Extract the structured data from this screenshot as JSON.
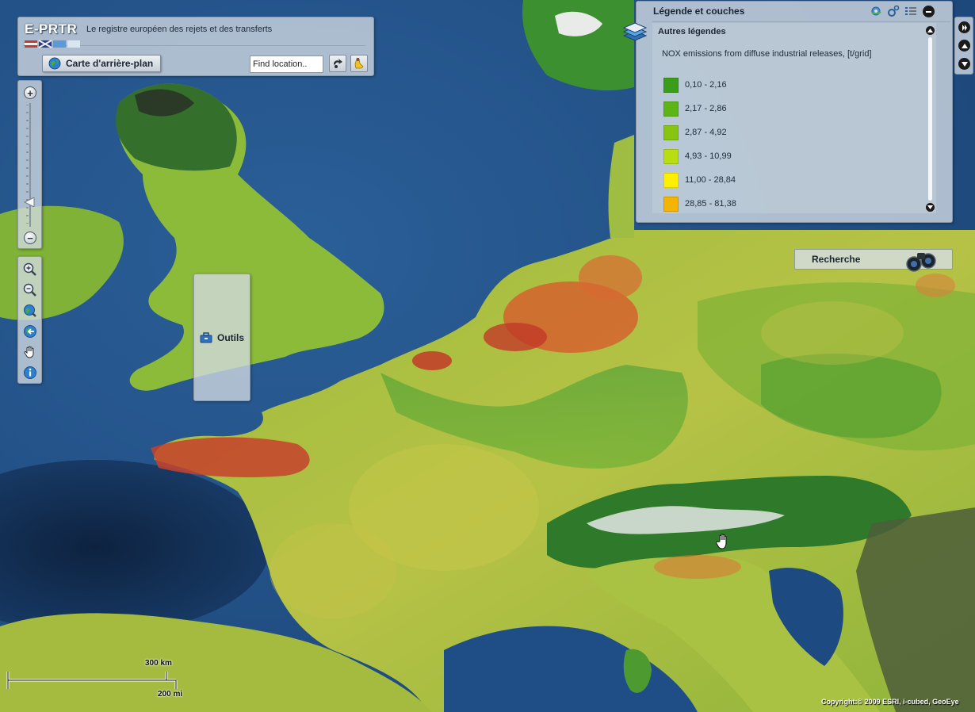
{
  "header": {
    "logo": "E-PRTR",
    "tagline": "Le registre européen des rejets et des transferts",
    "background_map_button": "Carte d'arrière-plan",
    "tools_button": "Outils",
    "find_placeholder": "Find location..",
    "icons": [
      "globe-icon",
      "toolbox-icon",
      "search-go-icon",
      "clear-icon"
    ]
  },
  "zoom_slider": {
    "level": 0.2,
    "icons": [
      "zoom-in-icon",
      "zoom-out-icon"
    ]
  },
  "nav_tools": {
    "icons": [
      "zoom-in-tool-icon",
      "zoom-out-tool-icon",
      "full-extent-icon",
      "previous-extent-icon",
      "pan-hand-icon",
      "identify-info-icon"
    ]
  },
  "legend": {
    "title": "Légende et couches",
    "section": "Autres légendes",
    "subtitle": "NOX emissions from diffuse industrial releases, [t/grid]",
    "entries": [
      {
        "label": "0,10 - 2,16",
        "color": "#3a9e1a"
      },
      {
        "label": "2,17 - 2,86",
        "color": "#5db515"
      },
      {
        "label": "2,87 - 4,92",
        "color": "#86c612"
      },
      {
        "label": "4,93 - 10,99",
        "color": "#b8de12"
      },
      {
        "label": "11,00 - 28,84",
        "color": "#fff000"
      },
      {
        "label": "28,85 - 81,38",
        "color": "#f5b400"
      }
    ],
    "icons": [
      "layers-icon",
      "gear-icon",
      "settings-icon",
      "list-icon",
      "minimize-icon",
      "scroll-up-icon",
      "scroll-down-icon"
    ]
  },
  "side_controls": {
    "icons": [
      "play-icon",
      "arrow-up-icon",
      "arrow-down-icon"
    ]
  },
  "search": {
    "label": "Recherche",
    "icon": "binoculars-icon"
  },
  "scale": {
    "km_label": "300 km",
    "mi_label": "200 mi"
  },
  "copyright": "Copyright:© 2009 ESRI, i-cubed, GeoEye"
}
